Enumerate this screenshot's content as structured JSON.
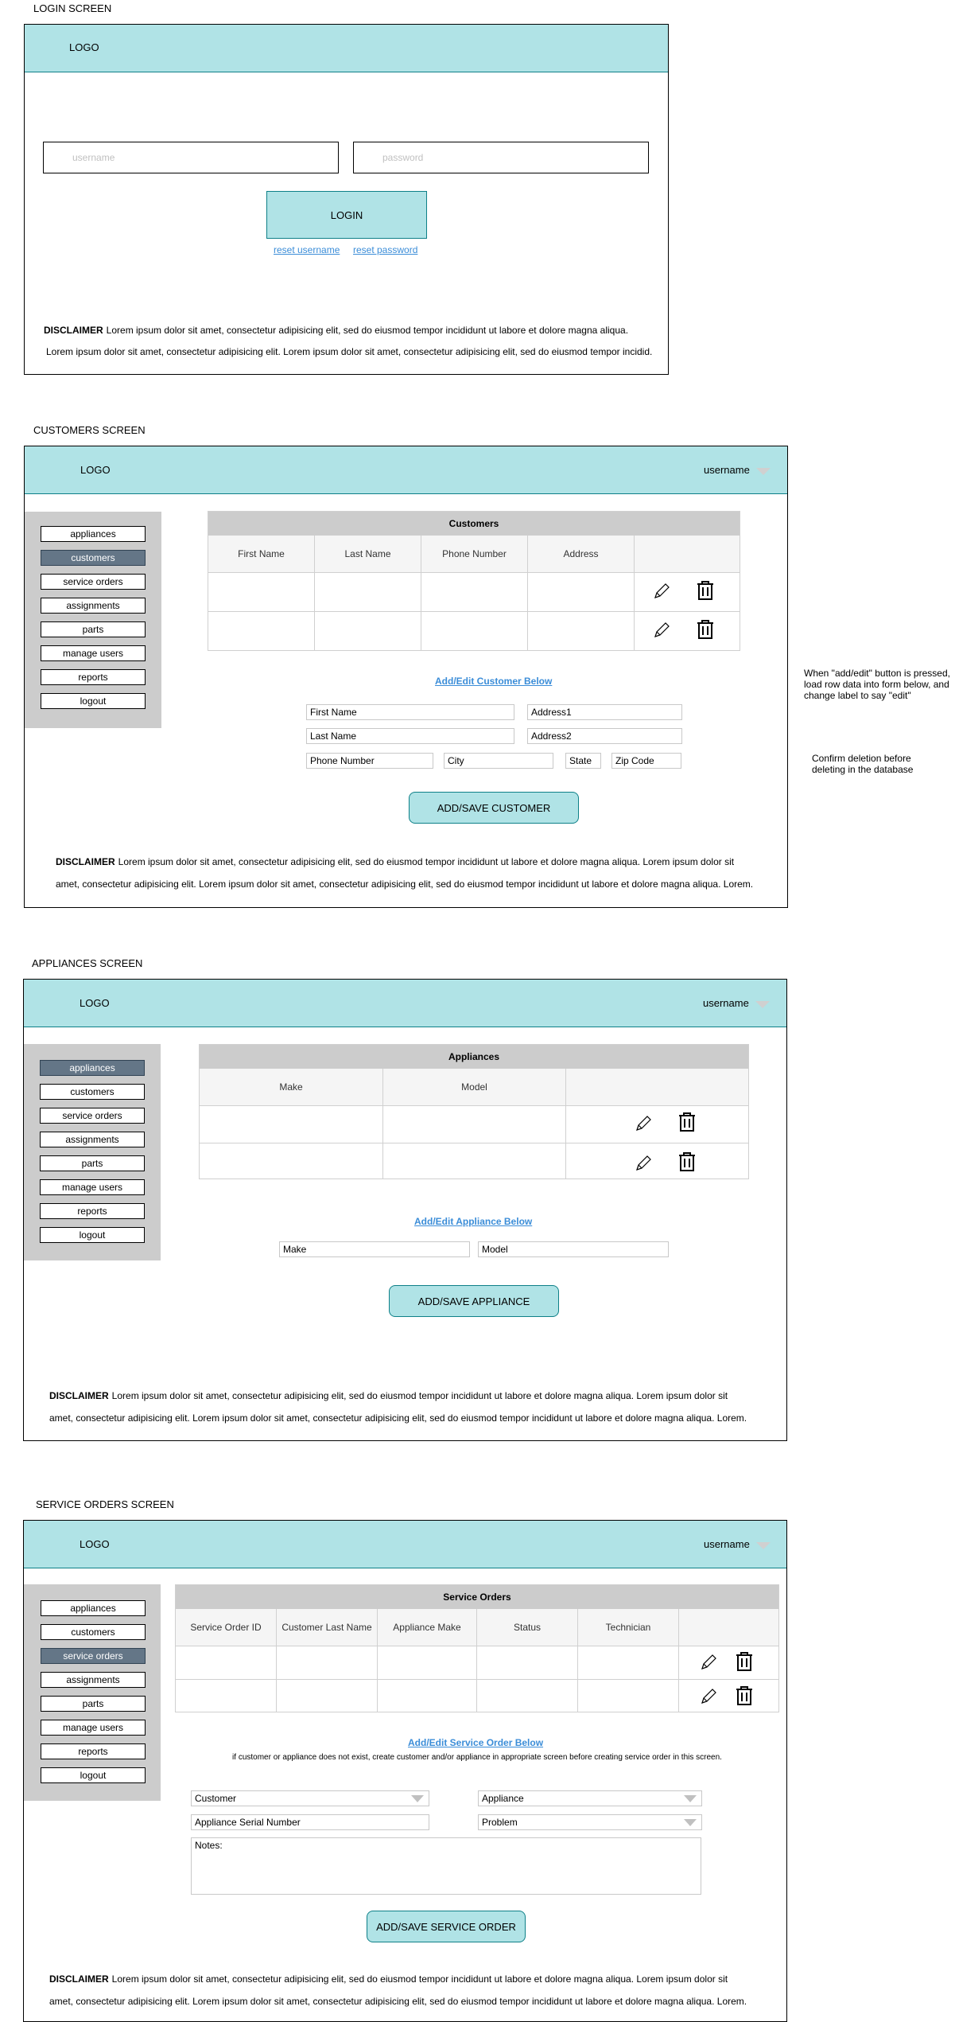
{
  "sections": {
    "login_title": "LOGIN SCREEN",
    "customers_title": "CUSTOMERS SCREEN",
    "appliances_title": "APPLIANCES SCREEN",
    "service_orders_title": "SERVICE ORDERS SCREEN"
  },
  "common": {
    "logo": "LOGO",
    "username": "username",
    "disclaimer_label": "DISCLAIMER"
  },
  "nav": [
    "appliances",
    "customers",
    "service orders",
    "assignments",
    "parts",
    "manage users",
    "reports",
    "logout"
  ],
  "login": {
    "username_placeholder": "username",
    "password_placeholder": "password",
    "login_button": "LOGIN",
    "reset_username": "reset username",
    "reset_password": "reset password",
    "disclaimer_line1": "Lorem ipsum dolor sit amet, consectetur adipisicing elit, sed do eiusmod tempor incididunt ut labore et dolore magna aliqua.",
    "disclaimer_line2": "Lorem ipsum dolor sit amet, consectetur adipisicing elit. Lorem ipsum dolor sit amet, consectetur adipisicing elit, sed do eiusmod tempor incidid."
  },
  "customers": {
    "table_title": "Customers",
    "columns": [
      "First Name",
      "Last Name",
      "Phone Number",
      "Address"
    ],
    "form_link": "Add/Edit Customer Below",
    "fields": {
      "first_name": "First Name",
      "address1": "Address1",
      "last_name": "Last Name",
      "address2": "Address2",
      "phone": "Phone Number",
      "city": "City",
      "state": "State",
      "zip": "Zip Code"
    },
    "save_button": "ADD/SAVE CUSTOMER",
    "disclaimer_line1": "Lorem ipsum dolor sit amet, consectetur adipisicing elit, sed do eiusmod tempor incididunt ut labore et dolore magna aliqua. Lorem ipsum dolor sit",
    "disclaimer_line2": "amet, consectetur adipisicing elit. Lorem ipsum dolor sit amet, consectetur adipisicing elit, sed do eiusmod tempor incididunt ut labore et dolore magna aliqua. Lorem.",
    "note_edit": "When \"add/edit\" button is pressed, load row data into form below, and change label to say \"edit\"",
    "note_delete": "Confirm deletion before deleting in the database"
  },
  "appliances": {
    "table_title": "Appliances",
    "columns": [
      "Make",
      "Model"
    ],
    "form_link": "Add/Edit Appliance Below",
    "fields": {
      "make": "Make",
      "model": "Model"
    },
    "save_button": "ADD/SAVE APPLIANCE",
    "disclaimer_line1": "Lorem ipsum dolor sit amet, consectetur adipisicing elit, sed do eiusmod tempor incididunt ut labore et dolore magna aliqua. Lorem ipsum dolor sit",
    "disclaimer_line2": "amet, consectetur adipisicing elit. Lorem ipsum dolor sit amet, consectetur adipisicing elit, sed do eiusmod tempor incididunt ut labore et dolore magna aliqua. Lorem."
  },
  "service_orders": {
    "table_title": "Service Orders",
    "columns": [
      "Service Order ID",
      "Customer Last Name",
      "Appliance Make",
      "Status",
      "Technician"
    ],
    "form_link": "Add/Edit Service Order Below",
    "form_hint": "if customer or appliance does not exist, create customer and/or appliance in appropriate screen before creating service order in this screen.",
    "fields": {
      "customer": "Customer",
      "appliance": "Appliance",
      "serial": "Appliance Serial Number",
      "problem": "Problem",
      "notes": "Notes:"
    },
    "save_button": "ADD/SAVE SERVICE ORDER",
    "disclaimer_line1": "Lorem ipsum dolor sit amet, consectetur adipisicing elit, sed do eiusmod tempor incididunt ut labore et dolore magna aliqua. Lorem ipsum dolor sit",
    "disclaimer_line2": "amet, consectetur adipisicing elit. Lorem ipsum dolor sit amet, consectetur adipisicing elit, sed do eiusmod tempor incididunt ut labore et dolore magna aliqua. Lorem."
  },
  "colors": {
    "topbar": "#b0e3e6",
    "topbar_border": "#0e8088",
    "sidebar": "#cccccc",
    "active_nav": "#647687",
    "link": "#3b8dd8"
  }
}
